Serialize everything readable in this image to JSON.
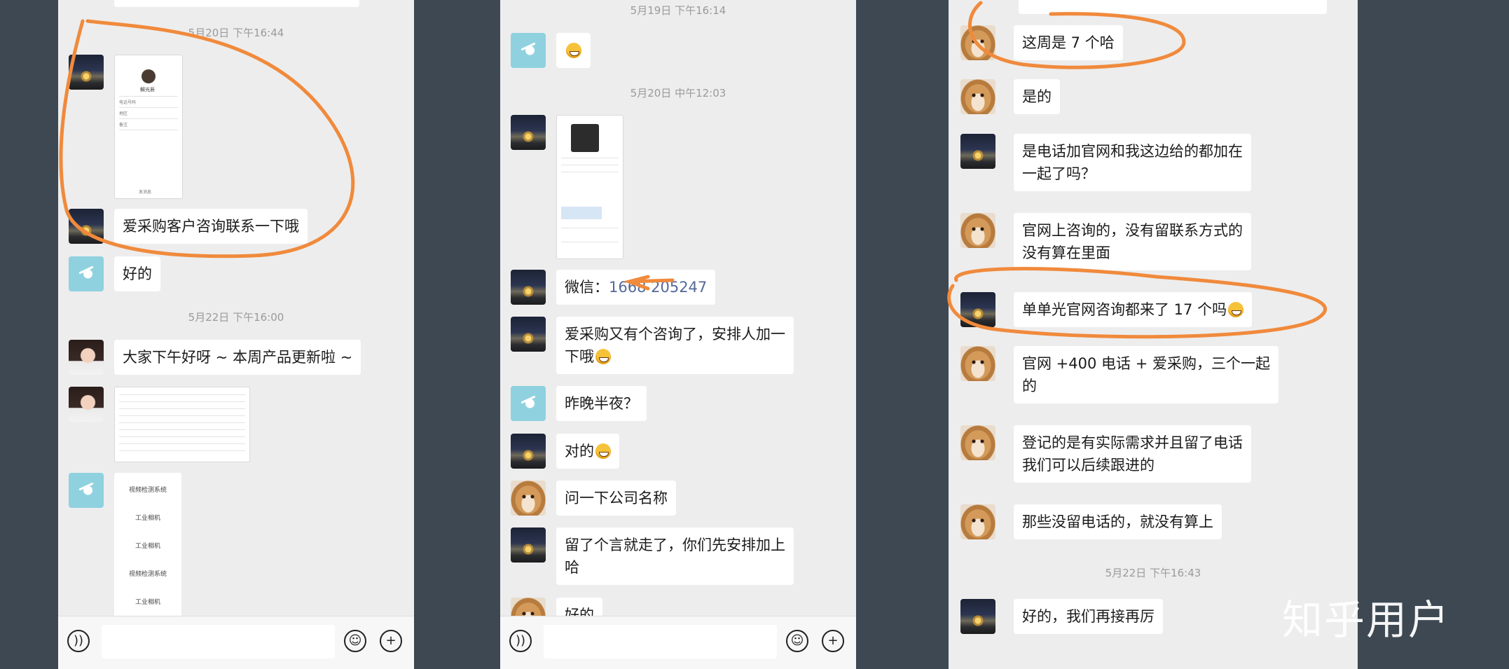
{
  "panel1": {
    "times": [
      "5月20日 下午16:44",
      "5月22日 下午16:00"
    ],
    "card": {
      "name": "解光辰",
      "rows": [
        "电话号码",
        "地区",
        "备注"
      ],
      "footer": "发消息"
    },
    "msg_inquiry": "爱采购客户咨询联系一下哦",
    "msg_ok": "好的",
    "msg_greeting": "大家下午好呀 ~ 本周产品更新啦 ~",
    "products": [
      "视频检测系统",
      "工业相机",
      "工业相机",
      "视频检测系统",
      "工业相机"
    ]
  },
  "panel2": {
    "times": [
      "5月19日 下午16:14",
      "5月20日 中午12:03"
    ],
    "wechat_label": "微信：",
    "wechat_number": "1668 205247",
    "msg_new_inquiry": "爱采购又有个咨询了，安排人加一\n下哦",
    "msg_last_night": "昨晚半夜？",
    "msg_right": "对的",
    "msg_company": "问一下公司名称",
    "msg_left_msg": "留了个言就走了，你们先安排加上\n哈",
    "msg_ok_partial": "好的"
  },
  "panel3": {
    "msg_week": "这周是 7 个哈",
    "msg_yes": "是的",
    "msg_phone_web": "是电话加官网和我这边给的都加在\n一起了吗？",
    "msg_web_inquiry": "官网上咨询的，没有留联系方式的\n没有算在里面",
    "msg_only_web": "单单光官网咨询都来了 17 个吗",
    "msg_three": "官网 +400 电话 + 爱采购，三个一起\n的",
    "msg_register": "登记的是有实际需求并且留了电话\n我们可以后续跟进的",
    "msg_no_phone": "那些没留电话的，就没有算上",
    "time": "5月22日 下午16:43",
    "msg_final": "好的，我们再接再厉"
  },
  "watermark": "知乎用户",
  "colors": {
    "annotation": "#f08a3c",
    "link": "#54699a",
    "background": "#3d4852",
    "chat_bg": "#ededed"
  }
}
